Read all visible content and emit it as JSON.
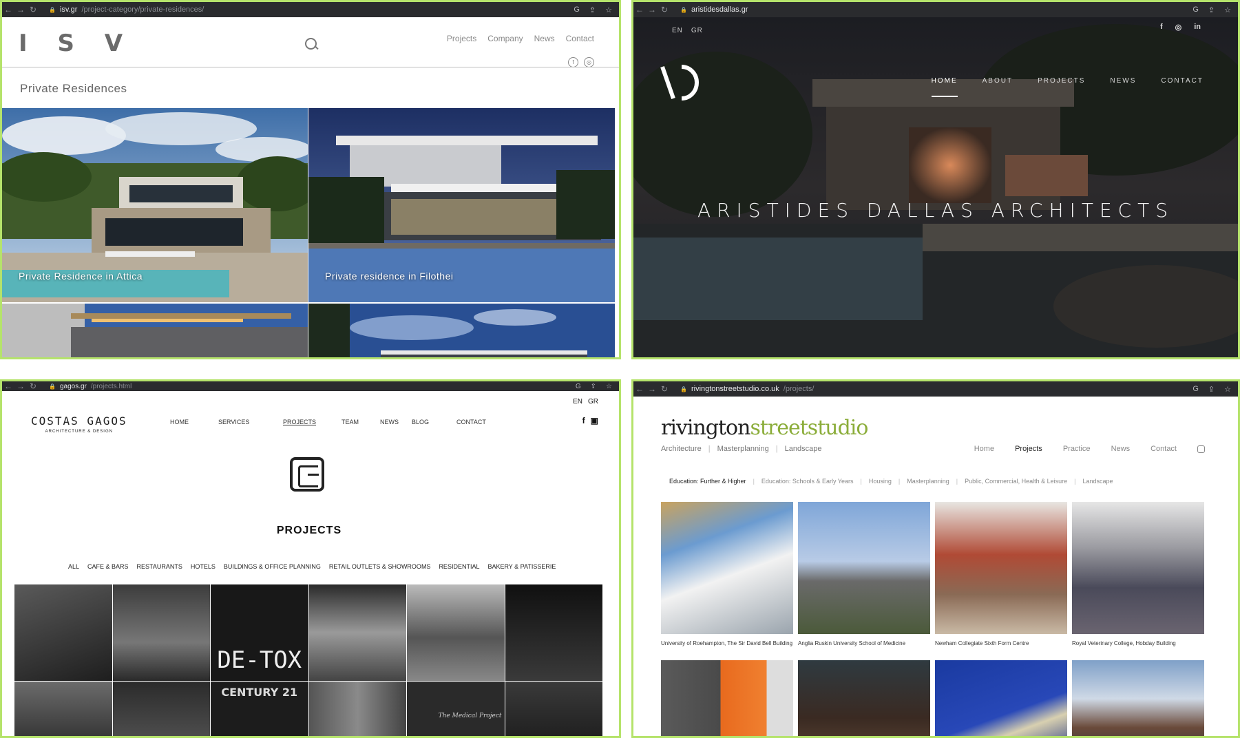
{
  "panels": {
    "isv": {
      "browser": {
        "host": "isv.gr",
        "path": "/project-category/private-residences/"
      },
      "logo": "I S V",
      "nav": [
        "Projects",
        "Company",
        "News",
        "Contact"
      ],
      "page_title": "Private Residences",
      "tiles": [
        {
          "caption": "Private Residence in Attica"
        },
        {
          "caption": "Private residence in Filothei"
        }
      ]
    },
    "dallas": {
      "browser": {
        "host": "aristidesdallas.gr",
        "path": ""
      },
      "lang": [
        "EN",
        "GR"
      ],
      "social": [
        "f",
        "◎",
        "in"
      ],
      "nav": [
        "HOME",
        "ABOUT",
        "PROJECTS",
        "NEWS",
        "CONTACT"
      ],
      "hero_title": "ARISTIDES DALLAS ARCHITECTS"
    },
    "gagos": {
      "browser": {
        "host": "gagos.gr",
        "path": "/projects.html"
      },
      "lang": [
        "EN",
        "GR"
      ],
      "logo_name": "COSTAS GAGOS",
      "logo_sub": "ARCHITECTURE & DESIGN",
      "nav": [
        "HOME",
        "SERVICES",
        "PROJECTS",
        "TEAM",
        "NEWS",
        "BLOG",
        "CONTACT"
      ],
      "page_title": "PROJECTS",
      "filters": [
        "ALL",
        "CAFE & BARS",
        "RESTAURANTS",
        "HOTELS",
        "BUILDINGS & OFFICE PLANNING",
        "RETAIL OUTLETS & SHOWROOMS",
        "RESIDENTIAL",
        "BAKERY & PATISSERIE"
      ],
      "tiles": [
        "",
        "",
        "DE-TOX",
        "",
        "",
        "",
        "",
        "",
        "CENTURY 21",
        "",
        "The Medical Project",
        ""
      ]
    },
    "rivington": {
      "browser": {
        "host": "rivingtonstreetstudio.co.uk",
        "path": "/projects/"
      },
      "logo_a": "rivington",
      "logo_b": "streetstudio",
      "sub_nav": [
        "Architecture",
        "Masterplanning",
        "Landscape"
      ],
      "nav": [
        "Home",
        "Projects",
        "Practice",
        "News",
        "Contact"
      ],
      "categories": [
        "Education: Further & Higher",
        "Education: Schools & Early Years",
        "Housing",
        "Masterplanning",
        "Public, Commercial, Health & Leisure",
        "Landscape"
      ],
      "projects": [
        {
          "caption": "University of Roehampton, The Sir David Bell Building"
        },
        {
          "caption": "Anglia Ruskin University School of Medicine"
        },
        {
          "caption": "Newham Collegiate Sixth Form Centre"
        },
        {
          "caption": "Royal Veterinary College, Hobday Building"
        }
      ]
    }
  },
  "colors": {
    "frame": "#b5e36b",
    "browser": "#2a2b2e",
    "rivington_green": "#8bad3a"
  }
}
